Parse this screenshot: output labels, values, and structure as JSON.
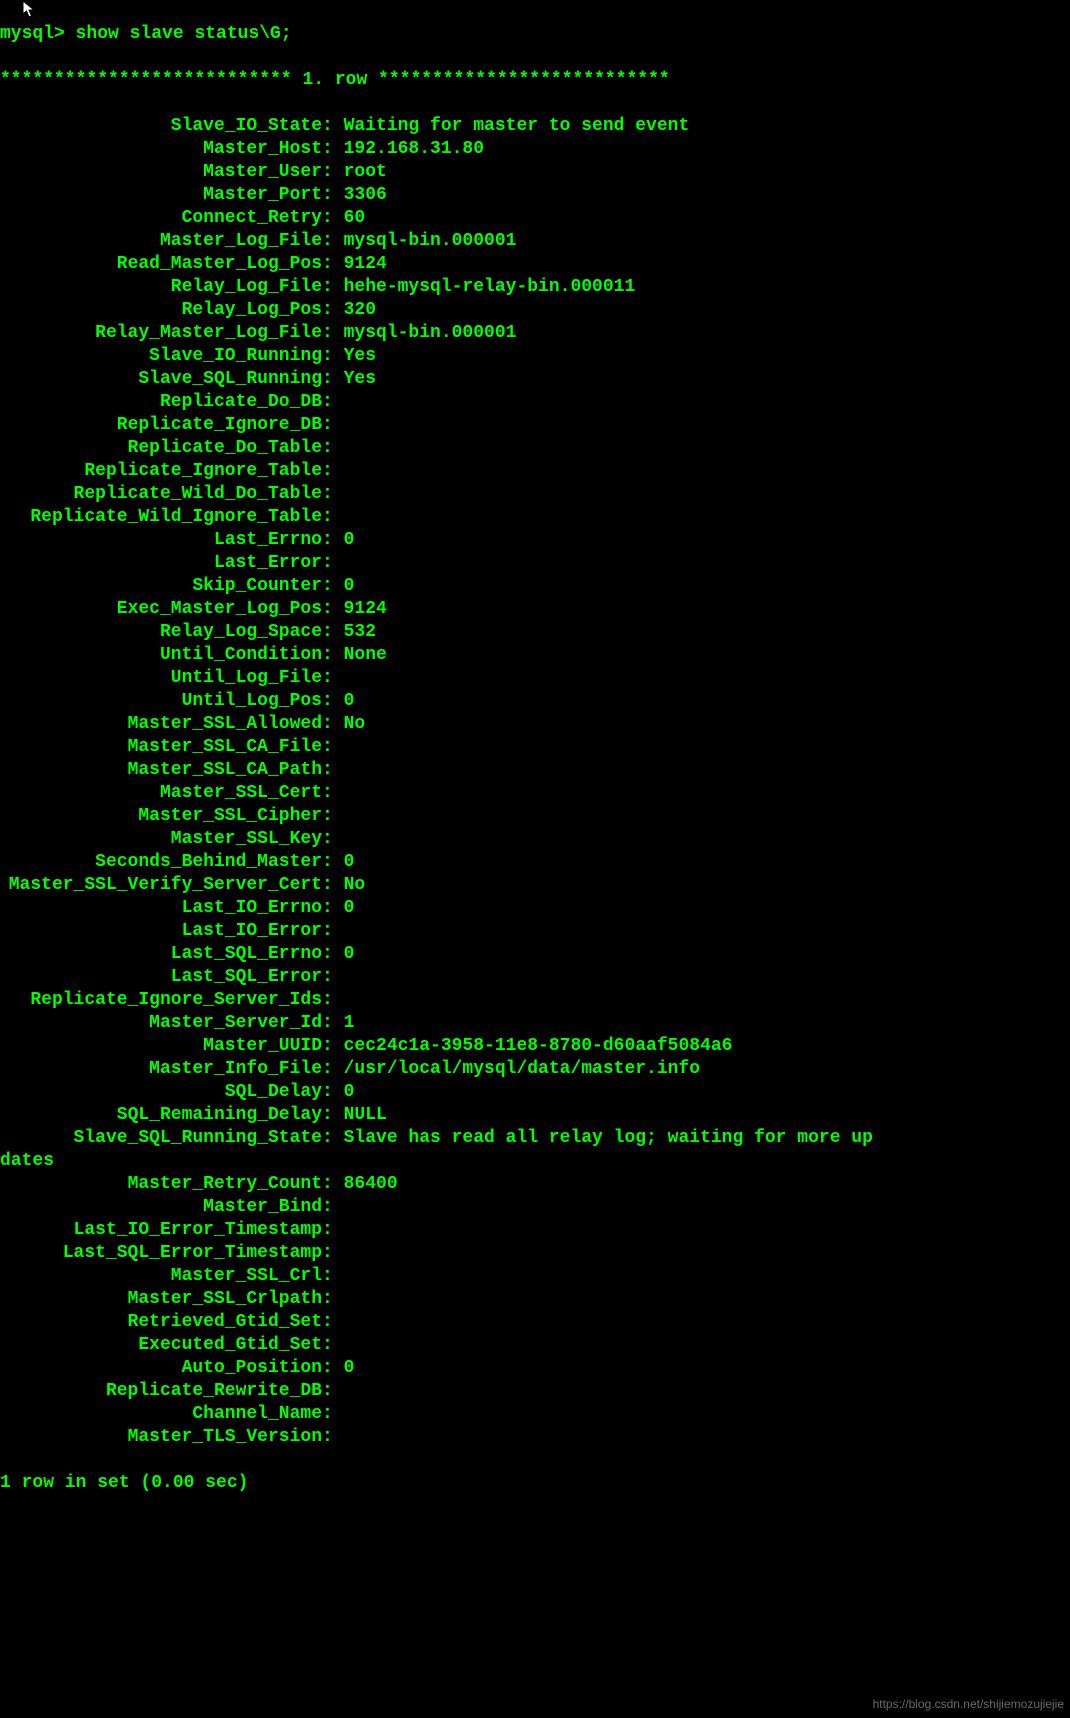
{
  "prompt": "mysql> ",
  "command": "show slave status\\G;",
  "row_header": "*************************** 1. row ***************************",
  "fields": [
    {
      "label": "Slave_IO_State",
      "value": "Waiting for master to send event"
    },
    {
      "label": "Master_Host",
      "value": "192.168.31.80"
    },
    {
      "label": "Master_User",
      "value": "root"
    },
    {
      "label": "Master_Port",
      "value": "3306"
    },
    {
      "label": "Connect_Retry",
      "value": "60"
    },
    {
      "label": "Master_Log_File",
      "value": "mysql-bin.000001"
    },
    {
      "label": "Read_Master_Log_Pos",
      "value": "9124"
    },
    {
      "label": "Relay_Log_File",
      "value": "hehe-mysql-relay-bin.000011"
    },
    {
      "label": "Relay_Log_Pos",
      "value": "320"
    },
    {
      "label": "Relay_Master_Log_File",
      "value": "mysql-bin.000001"
    },
    {
      "label": "Slave_IO_Running",
      "value": "Yes"
    },
    {
      "label": "Slave_SQL_Running",
      "value": "Yes"
    },
    {
      "label": "Replicate_Do_DB",
      "value": ""
    },
    {
      "label": "Replicate_Ignore_DB",
      "value": ""
    },
    {
      "label": "Replicate_Do_Table",
      "value": ""
    },
    {
      "label": "Replicate_Ignore_Table",
      "value": ""
    },
    {
      "label": "Replicate_Wild_Do_Table",
      "value": ""
    },
    {
      "label": "Replicate_Wild_Ignore_Table",
      "value": ""
    },
    {
      "label": "Last_Errno",
      "value": "0"
    },
    {
      "label": "Last_Error",
      "value": ""
    },
    {
      "label": "Skip_Counter",
      "value": "0"
    },
    {
      "label": "Exec_Master_Log_Pos",
      "value": "9124"
    },
    {
      "label": "Relay_Log_Space",
      "value": "532"
    },
    {
      "label": "Until_Condition",
      "value": "None"
    },
    {
      "label": "Until_Log_File",
      "value": ""
    },
    {
      "label": "Until_Log_Pos",
      "value": "0"
    },
    {
      "label": "Master_SSL_Allowed",
      "value": "No"
    },
    {
      "label": "Master_SSL_CA_File",
      "value": ""
    },
    {
      "label": "Master_SSL_CA_Path",
      "value": ""
    },
    {
      "label": "Master_SSL_Cert",
      "value": ""
    },
    {
      "label": "Master_SSL_Cipher",
      "value": ""
    },
    {
      "label": "Master_SSL_Key",
      "value": ""
    },
    {
      "label": "Seconds_Behind_Master",
      "value": "0"
    },
    {
      "label": "Master_SSL_Verify_Server_Cert",
      "value": "No"
    },
    {
      "label": "Last_IO_Errno",
      "value": "0"
    },
    {
      "label": "Last_IO_Error",
      "value": ""
    },
    {
      "label": "Last_SQL_Errno",
      "value": "0"
    },
    {
      "label": "Last_SQL_Error",
      "value": ""
    },
    {
      "label": "Replicate_Ignore_Server_Ids",
      "value": ""
    },
    {
      "label": "Master_Server_Id",
      "value": "1"
    },
    {
      "label": "Master_UUID",
      "value": "cec24c1a-3958-11e8-8780-d60aaf5084a6"
    },
    {
      "label": "Master_Info_File",
      "value": "/usr/local/mysql/data/master.info"
    },
    {
      "label": "SQL_Delay",
      "value": "0"
    },
    {
      "label": "SQL_Remaining_Delay",
      "value": "NULL"
    },
    {
      "label": "Slave_SQL_Running_State",
      "value": "Slave has read all relay log; waiting for more up"
    },
    {
      "label": "__wrap__",
      "value": "dates"
    },
    {
      "label": "Master_Retry_Count",
      "value": "86400"
    },
    {
      "label": "Master_Bind",
      "value": ""
    },
    {
      "label": "Last_IO_Error_Timestamp",
      "value": ""
    },
    {
      "label": "Last_SQL_Error_Timestamp",
      "value": ""
    },
    {
      "label": "Master_SSL_Crl",
      "value": ""
    },
    {
      "label": "Master_SSL_Crlpath",
      "value": ""
    },
    {
      "label": "Retrieved_Gtid_Set",
      "value": ""
    },
    {
      "label": "Executed_Gtid_Set",
      "value": ""
    },
    {
      "label": "Auto_Position",
      "value": "0"
    },
    {
      "label": "Replicate_Rewrite_DB",
      "value": ""
    },
    {
      "label": "Channel_Name",
      "value": ""
    },
    {
      "label": "Master_TLS_Version",
      "value": ""
    }
  ],
  "footer": "1 row in set (0.00 sec)",
  "watermark": "https://blog.csdn.net/shijiemozujiejie"
}
